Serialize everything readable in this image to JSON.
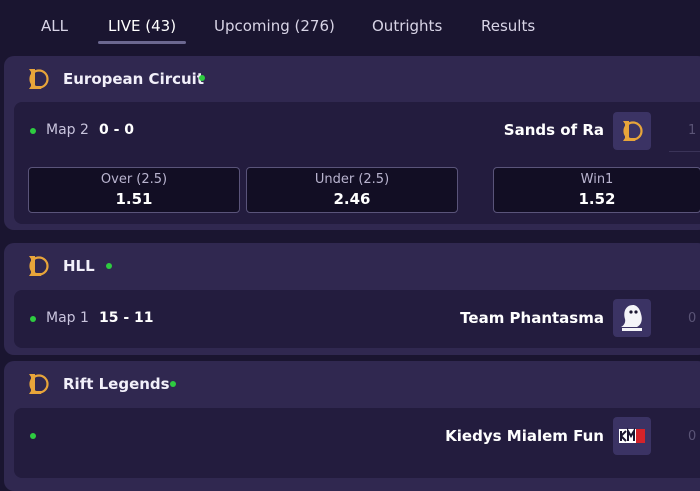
{
  "tabs": [
    {
      "label": "ALL"
    },
    {
      "label": "LIVE (43)"
    },
    {
      "label": "Upcoming (276)"
    },
    {
      "label": "Outrights"
    },
    {
      "label": "Results"
    }
  ],
  "leagues": [
    {
      "name": "European Circuit",
      "match": {
        "map": "Map 2",
        "score": "0 - 0",
        "team": "Sands of Ra",
        "right_score": "1",
        "odds": [
          {
            "label": "Over (2.5)",
            "value": "1.51"
          },
          {
            "label": "Under (2.5)",
            "value": "2.46"
          },
          {
            "label": "Win1",
            "value": "1.52"
          }
        ]
      }
    },
    {
      "name": "HLL",
      "match": {
        "map": "Map 1",
        "score": "15 - 11",
        "team": "Team Phantasma",
        "right_score": "0"
      }
    },
    {
      "name": "Rift Legends",
      "match": {
        "team": "Kiedys Mialem Fun",
        "right_score": "0"
      }
    }
  ],
  "colors": {
    "background": "#1a1530",
    "card": "#302850",
    "row": "#231c3e",
    "live_dot": "#2ecc40",
    "lol_gold": "#e8a53a"
  }
}
